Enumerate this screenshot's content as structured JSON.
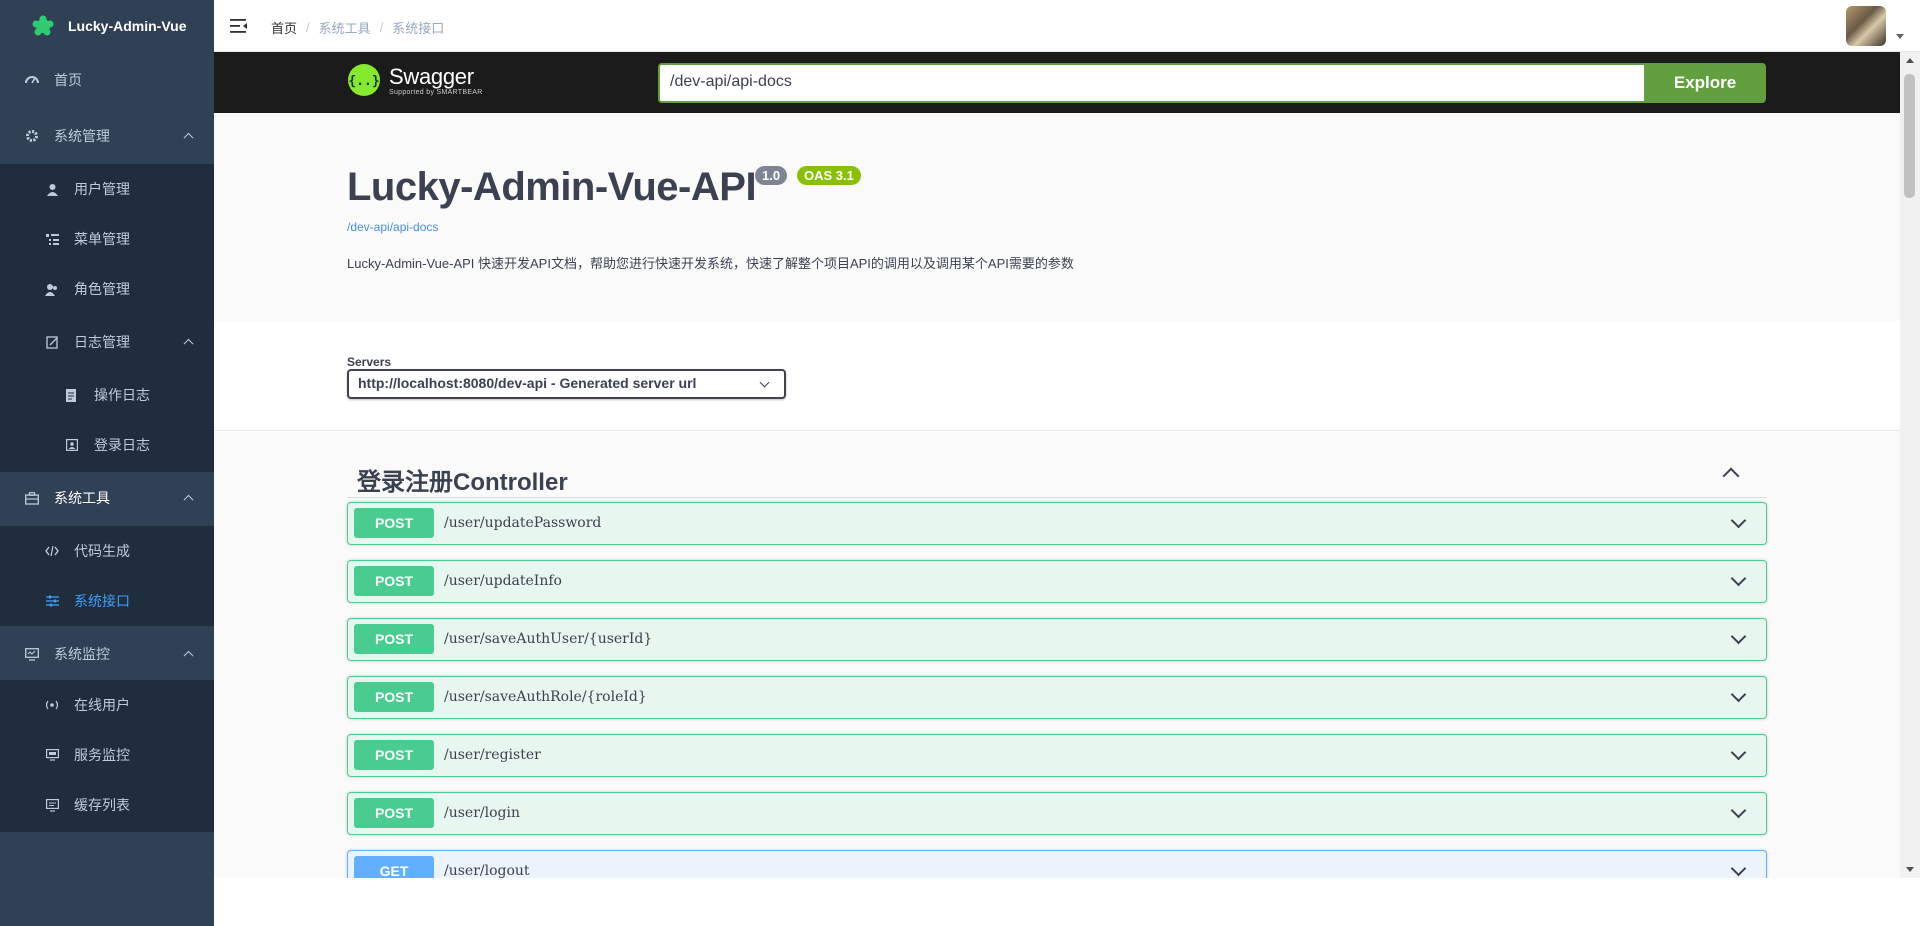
{
  "app": {
    "title": "Lucky-Admin-Vue"
  },
  "sidebar": {
    "items": [
      {
        "label": "首页",
        "icon": "dashboard-icon"
      },
      {
        "label": "系统管理",
        "icon": "gear-icon"
      },
      {
        "label": "用户管理",
        "icon": "user-icon"
      },
      {
        "label": "菜单管理",
        "icon": "tree-table-icon"
      },
      {
        "label": "角色管理",
        "icon": "peoples-icon"
      },
      {
        "label": "日志管理",
        "icon": "log-icon"
      },
      {
        "label": "操作日志",
        "icon": "form-icon"
      },
      {
        "label": "登录日志",
        "icon": "logininfor-icon"
      },
      {
        "label": "系统工具",
        "icon": "toolbox-icon"
      },
      {
        "label": "代码生成",
        "icon": "code-icon"
      },
      {
        "label": "系统接口",
        "icon": "swagger-icon"
      },
      {
        "label": "系统监控",
        "icon": "monitor-icon"
      },
      {
        "label": "在线用户",
        "icon": "online-icon"
      },
      {
        "label": "服务监控",
        "icon": "server-icon"
      },
      {
        "label": "缓存列表",
        "icon": "redis-list-icon"
      }
    ]
  },
  "breadcrumb": {
    "items": [
      "首页",
      "系统工具",
      "系统接口"
    ]
  },
  "swagger": {
    "brand": "Swagger",
    "brand_sub": "Supported by SMARTBEAR",
    "url_value": "/dev-api/api-docs",
    "explore_label": "Explore",
    "api_title": "Lucky-Admin-Vue-API",
    "version": "1.0",
    "oas": "OAS 3.1",
    "doc_link": "/dev-api/api-docs",
    "description": "Lucky-Admin-Vue-API 快速开发API文档，帮助您进行快速开发系统，快速了解整个项目API的调用以及调用某个API需要的参数",
    "servers_label": "Servers",
    "server_selected": "http://localhost:8080/dev-api - Generated server url",
    "tag": "登录注册Controller",
    "operations": [
      {
        "method": "POST",
        "path": "/user/updatePassword"
      },
      {
        "method": "POST",
        "path": "/user/updateInfo"
      },
      {
        "method": "POST",
        "path": "/user/saveAuthUser/{userId}"
      },
      {
        "method": "POST",
        "path": "/user/saveAuthRole/{roleId}"
      },
      {
        "method": "POST",
        "path": "/user/register"
      },
      {
        "method": "POST",
        "path": "/user/login"
      },
      {
        "method": "GET",
        "path": "/user/logout"
      }
    ]
  },
  "colors": {
    "sidebar_bg": "#304156",
    "submenu_bg": "#1f2d3d",
    "active": "#409eff",
    "post": "#49cc90",
    "get": "#61affe",
    "explore": "#62a03f"
  }
}
